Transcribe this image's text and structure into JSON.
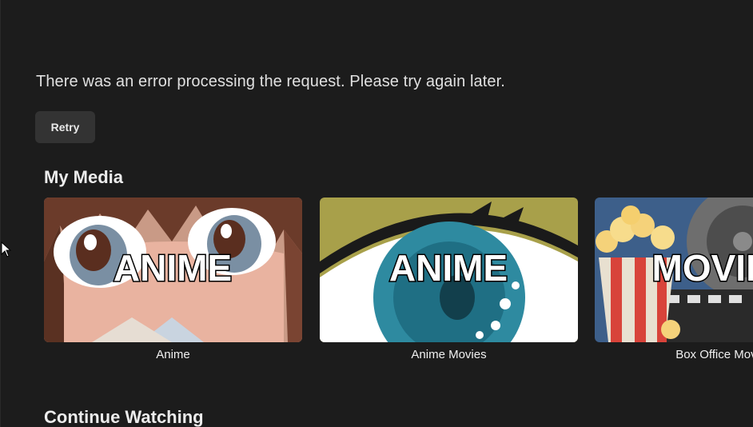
{
  "error": {
    "message": "There was an error processing the request. Please try again later.",
    "retry_label": "Retry"
  },
  "sections": {
    "my_media": {
      "title": "My Media",
      "items": [
        {
          "label": "Anime",
          "overlay": "ANIME"
        },
        {
          "label": "Anime Movies",
          "overlay": "ANIME"
        },
        {
          "label": "Box Office Movies",
          "overlay": "MOVIES"
        }
      ]
    },
    "continue_watching": {
      "title": "Continue Watching"
    }
  },
  "colors": {
    "background": "#1c1c1c",
    "button": "#333333",
    "text": "#e6e6e6"
  },
  "icons": [
    "mouse-pointer-icon"
  ]
}
